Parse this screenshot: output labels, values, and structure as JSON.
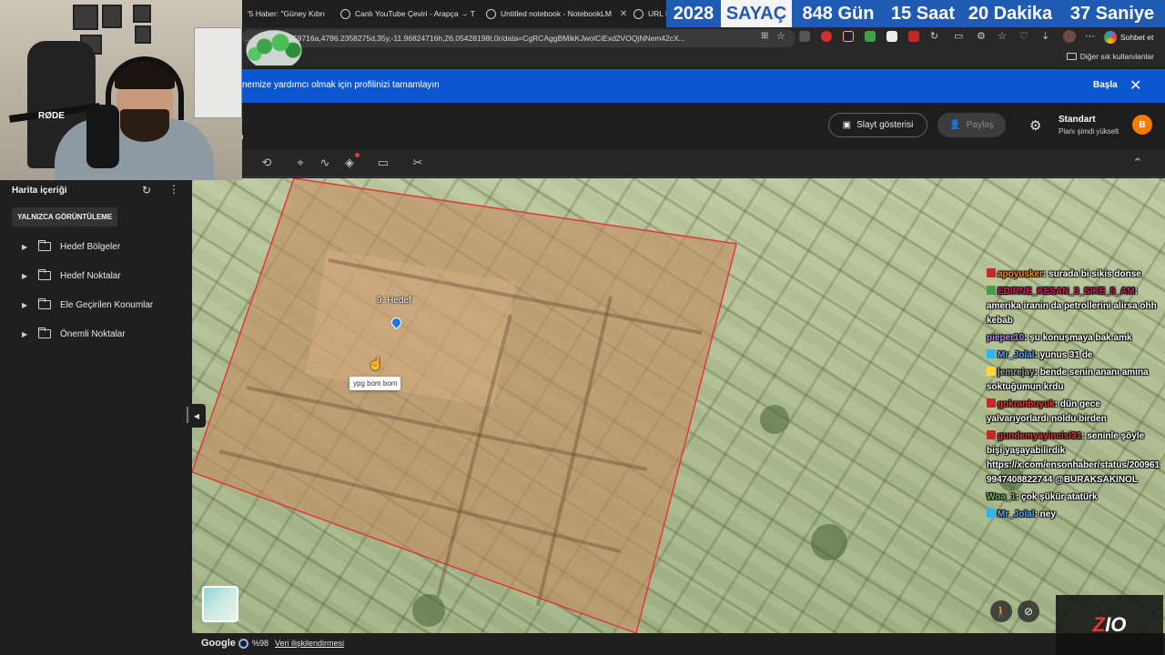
{
  "browser": {
    "tabs": [
      {
        "label": "'5 Haber: \"Güney Kıbrı",
        "x": 0
      },
      {
        "label": "Canlı YouTube Çeviri - Arapça → T",
        "x": 0
      },
      {
        "label": "Untitled notebook - NotebookLM",
        "x": 0
      },
      {
        "label": "URL N",
        "x": 0
      }
    ],
    "counter": {
      "year": "2028",
      "title": "SAYAÇ",
      "days": "848 Gün",
      "hours": "15 Saat",
      "minutes": "20 Dakika",
      "seconds": "37 Saniye"
    },
    "address": "...,406.421.8059716a,4786.2358275d,35y,-11.96824716h,26.05428198t,0r/data=CgRCAggBMikKJwolCiExd2VOQjNNem42cX...",
    "chat_button": "Sohbet et",
    "bookmarks_folder": "Diğer sık kullanılanlar"
  },
  "banner": {
    "message": "nemize yardımcı olmak için profilinizi tamamlayın",
    "start": "Başla",
    "close_icon": "close-icon"
  },
  "header": {
    "stray_letter": "n",
    "slideshow": "Slayt gösterisi",
    "share": "Paylaş",
    "plan_name": "Standart",
    "plan_upgrade": "Planı şimdi yükselt",
    "avatar_letter": "B"
  },
  "panel": {
    "title": "Harita içeriği",
    "view_only": "YALNIZCA GÖRÜNTÜLEME",
    "folders": [
      "Hedef Bölgeler",
      "Hedef Noktalar",
      "Ele Geçirilen Konumlar",
      "Önemli Noktalar"
    ]
  },
  "map": {
    "pin_label": "9. Hedef",
    "tooltip": "ypg bom bom",
    "polygon_color": "#e0383b"
  },
  "status": {
    "google": "Google",
    "percent": "%98",
    "attribution": "Veri ilişkilendirmesi"
  },
  "webcam": {
    "mic_brand": "RØDE"
  },
  "chat": [
    {
      "user": "apoyusker",
      "color": "#ff8a1e",
      "badge": "#c62828",
      "text": ": surada bi sikis donse"
    },
    {
      "user": "EDIRNE_KESAN_3_SIKE_5_AM",
      "color": "#d81b60",
      "badge": "#43a047",
      "text": ": amerika iranin da petrollerini alirsa ohh kebab"
    },
    {
      "user": "pieper10",
      "color": "#b388ff",
      "badge": "",
      "text": ": şu konuşmaya bak amk"
    },
    {
      "user": "Mr_Jolal",
      "color": "#5aa9ff",
      "badge": "#29b6f6",
      "text": ": yunus 31 de"
    },
    {
      "user": "jemrejay",
      "color": "#a0a0a0",
      "badge": "#fdd835",
      "text": ": bende senin ananı amına soktuğumun krdu"
    },
    {
      "user": "gokranbuyuk",
      "color": "#e53935",
      "badge": "#c62828",
      "text": ": dün gece yalvarıyorlardı noldu birden"
    },
    {
      "user": "gundemyayincisi31",
      "color": "#e53935",
      "badge": "#c62828",
      "text": ": seninle şöyle bişi yaşayabilirdik https://x.com/ensonhaber/status/2009619947408822744 @BURAKSAKINOL"
    },
    {
      "user": "Woa_1",
      "color": "#66bb6a",
      "badge": "",
      "text": ": çok şükür atatürk"
    },
    {
      "user": "Mr_Jolal",
      "color": "#5aa9ff",
      "badge": "#29b6f6",
      "text": ": ney"
    }
  ],
  "logo": {
    "z": "Z",
    "rest": "IO"
  }
}
